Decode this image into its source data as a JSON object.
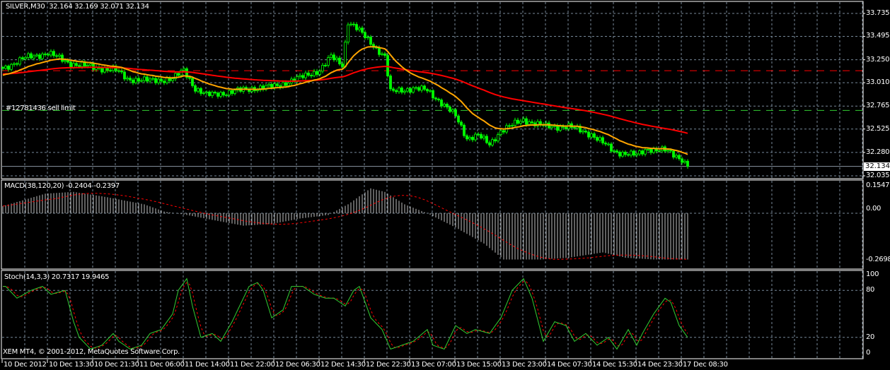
{
  "header": {
    "symbol": "SILVER,M30",
    "open": "32.164",
    "high": "32.169",
    "low": "32.071",
    "close": "32.134"
  },
  "order_label": "#12781436 sell limit",
  "current_price": "32.134",
  "price_axis": [
    "33.735",
    "33.495",
    "33.250",
    "33.010",
    "32.765",
    "32.525",
    "32.280",
    "32.035"
  ],
  "macd": {
    "label": "MACD(38,120,20) -0.2404 -0.2397",
    "axis": [
      "0.1547",
      "0.00",
      "-0.2698"
    ]
  },
  "stoch": {
    "label": "Stoch(14,3,3) 20.7317 19.9465",
    "axis": [
      "100",
      "80",
      "20",
      "0"
    ]
  },
  "copyright": "XEM MT4, © 2001-2012, MetaQuotes Software Corp.",
  "time_axis": [
    "10 Dec 2012",
    "10 Dec 13:30",
    "10 Dec 21:30",
    "11 Dec 06:00",
    "11 Dec 14:00",
    "11 Dec 22:00",
    "12 Dec 06:30",
    "12 Dec 14:30",
    "12 Dec 22:30",
    "13 Dec 07:00",
    "13 Dec 15:00",
    "13 Dec 23:00",
    "14 Dec 07:30",
    "14 Dec 15:30",
    "14 Dec 23:30",
    "17 Dec 08:30"
  ],
  "colors": {
    "bg": "#000000",
    "grid": "#778899",
    "candles": "#00ff00",
    "ma_fast": "#ffa500",
    "ma_slow": "#ff0000",
    "sell_limit": "#32cd32",
    "tp_line": "#ff0000",
    "stoch_main": "#32cd32",
    "stoch_signal": "#ff0000",
    "macd_hist": "#c0c0c0",
    "macd_signal": "#ff0000"
  },
  "chart_data": {
    "type": "candlestick",
    "symbol": "SILVER",
    "timeframe": "M30",
    "bars": 243,
    "ylim": [
      32.035,
      33.735
    ],
    "close_keypoints": [
      [
        0,
        33.16
      ],
      [
        8,
        33.27
      ],
      [
        16,
        33.32
      ],
      [
        24,
        33.21
      ],
      [
        32,
        33.17
      ],
      [
        40,
        33.14
      ],
      [
        44,
        33.05
      ],
      [
        52,
        33.03
      ],
      [
        60,
        33.05
      ],
      [
        64,
        33.14
      ],
      [
        68,
        32.95
      ],
      [
        72,
        32.88
      ],
      [
        80,
        32.91
      ],
      [
        88,
        32.95
      ],
      [
        96,
        32.97
      ],
      [
        104,
        33.05
      ],
      [
        112,
        33.14
      ],
      [
        116,
        33.28
      ],
      [
        120,
        33.2
      ],
      [
        122,
        33.65
      ],
      [
        125,
        33.58
      ],
      [
        130,
        33.43
      ],
      [
        135,
        33.28
      ],
      [
        137,
        32.91
      ],
      [
        140,
        32.93
      ],
      [
        145,
        32.95
      ],
      [
        150,
        32.93
      ],
      [
        155,
        32.8
      ],
      [
        160,
        32.66
      ],
      [
        164,
        32.43
      ],
      [
        168,
        32.46
      ],
      [
        172,
        32.36
      ],
      [
        176,
        32.51
      ],
      [
        184,
        32.62
      ],
      [
        192,
        32.55
      ],
      [
        200,
        32.55
      ],
      [
        208,
        32.47
      ],
      [
        216,
        32.29
      ],
      [
        224,
        32.25
      ],
      [
        228,
        32.32
      ],
      [
        234,
        32.3
      ],
      [
        240,
        32.21
      ],
      [
        242,
        32.14
      ]
    ],
    "ma_periods": [
      20,
      90
    ],
    "hlines": {
      "red_dashed": 33.135,
      "sell_limit": 32.72,
      "bid": 32.134
    },
    "macd_keypoints": [
      [
        0,
        0.04
      ],
      [
        15,
        0.11
      ],
      [
        25,
        0.12
      ],
      [
        37,
        0.09
      ],
      [
        50,
        0.05
      ],
      [
        57,
        0.01
      ],
      [
        65,
        -0.01
      ],
      [
        75,
        -0.04
      ],
      [
        85,
        -0.07
      ],
      [
        95,
        -0.06
      ],
      [
        105,
        -0.03
      ],
      [
        115,
        -0.01
      ],
      [
        122,
        0.05
      ],
      [
        130,
        0.14
      ],
      [
        135,
        0.12
      ],
      [
        142,
        0.05
      ],
      [
        150,
        0.0
      ],
      [
        160,
        -0.08
      ],
      [
        170,
        -0.17
      ],
      [
        177,
        -0.26
      ],
      [
        190,
        -0.26
      ],
      [
        200,
        -0.25
      ],
      [
        212,
        -0.22
      ],
      [
        220,
        -0.25
      ],
      [
        230,
        -0.26
      ],
      [
        242,
        -0.26
      ]
    ],
    "macd_ylim": [
      -0.2698,
      0.1547
    ],
    "stoch_keypoints": [
      [
        1,
        85
      ],
      [
        5,
        70
      ],
      [
        10,
        80
      ],
      [
        14,
        85
      ],
      [
        17,
        75
      ],
      [
        22,
        80
      ],
      [
        25,
        40
      ],
      [
        27,
        20
      ],
      [
        31,
        5
      ],
      [
        35,
        10
      ],
      [
        39,
        25
      ],
      [
        41,
        15
      ],
      [
        45,
        5
      ],
      [
        49,
        10
      ],
      [
        52,
        25
      ],
      [
        56,
        30
      ],
      [
        60,
        50
      ],
      [
        62,
        80
      ],
      [
        65,
        95
      ],
      [
        67,
        60
      ],
      [
        70,
        20
      ],
      [
        74,
        25
      ],
      [
        77,
        15
      ],
      [
        81,
        40
      ],
      [
        85,
        70
      ],
      [
        87,
        85
      ],
      [
        90,
        90
      ],
      [
        92,
        80
      ],
      [
        95,
        45
      ],
      [
        99,
        55
      ],
      [
        102,
        85
      ],
      [
        106,
        85
      ],
      [
        110,
        75
      ],
      [
        114,
        70
      ],
      [
        117,
        70
      ],
      [
        121,
        60
      ],
      [
        124,
        80
      ],
      [
        126,
        85
      ],
      [
        130,
        45
      ],
      [
        134,
        30
      ],
      [
        137,
        5
      ],
      [
        141,
        10
      ],
      [
        145,
        15
      ],
      [
        150,
        30
      ],
      [
        152,
        10
      ],
      [
        156,
        5
      ],
      [
        160,
        35
      ],
      [
        164,
        25
      ],
      [
        167,
        30
      ],
      [
        172,
        25
      ],
      [
        176,
        45
      ],
      [
        180,
        80
      ],
      [
        184,
        95
      ],
      [
        187,
        70
      ],
      [
        191,
        15
      ],
      [
        195,
        40
      ],
      [
        199,
        35
      ],
      [
        202,
        15
      ],
      [
        206,
        25
      ],
      [
        210,
        10
      ],
      [
        214,
        20
      ],
      [
        217,
        5
      ],
      [
        221,
        30
      ],
      [
        224,
        10
      ],
      [
        226,
        25
      ],
      [
        230,
        50
      ],
      [
        234,
        70
      ],
      [
        236,
        65
      ],
      [
        239,
        35
      ],
      [
        242,
        20
      ]
    ],
    "stoch_levels": [
      80,
      20
    ]
  }
}
